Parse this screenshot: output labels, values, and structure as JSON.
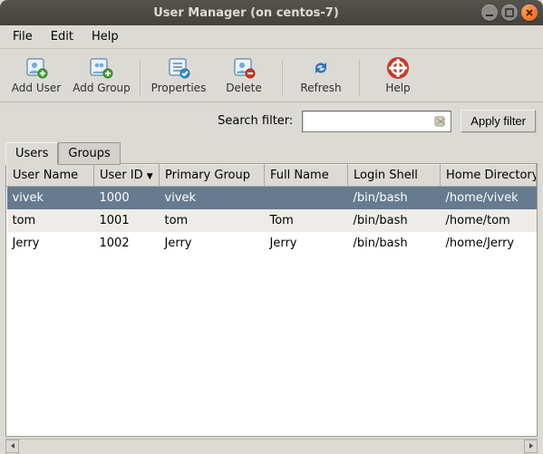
{
  "window": {
    "title": "User Manager (on centos-7)"
  },
  "menu": {
    "file": "File",
    "edit": "Edit",
    "help": "Help"
  },
  "toolbar": {
    "add_user": "Add User",
    "add_group": "Add Group",
    "properties": "Properties",
    "delete": "Delete",
    "refresh": "Refresh",
    "help": "Help"
  },
  "filter": {
    "label": "Search filter:",
    "value": "",
    "apply": "Apply filter"
  },
  "tabs": {
    "users": "Users",
    "groups": "Groups",
    "active": "users"
  },
  "columns": {
    "user_name": "User Name",
    "user_id": "User ID",
    "primary_group": "Primary Group",
    "full_name": "Full Name",
    "login_shell": "Login Shell",
    "home_dir": "Home Directory",
    "sorted_by": "user_id",
    "sort_dir": "desc"
  },
  "rows": [
    {
      "user_name": "vivek",
      "user_id": "1000",
      "primary_group": "vivek",
      "full_name": "",
      "login_shell": "/bin/bash",
      "home_dir": "/home/vivek",
      "selected": true
    },
    {
      "user_name": "tom",
      "user_id": "1001",
      "primary_group": "tom",
      "full_name": "Tom",
      "login_shell": "/bin/bash",
      "home_dir": "/home/tom",
      "selected": false
    },
    {
      "user_name": "Jerry",
      "user_id": "1002",
      "primary_group": "Jerry",
      "full_name": "Jerry",
      "login_shell": "/bin/bash",
      "home_dir": "/home/Jerry",
      "selected": false
    }
  ]
}
